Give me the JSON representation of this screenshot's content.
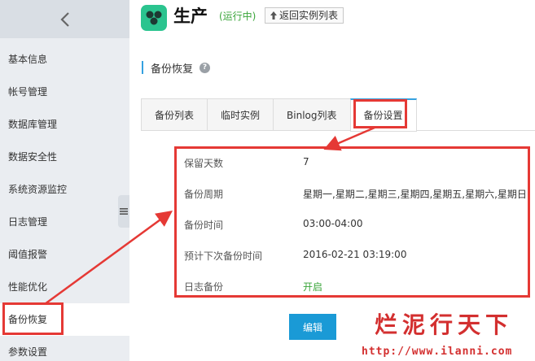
{
  "sidebar": {
    "items": [
      {
        "label": "基本信息"
      },
      {
        "label": "帐号管理"
      },
      {
        "label": "数据库管理"
      },
      {
        "label": "数据安全性"
      },
      {
        "label": "系统资源监控"
      },
      {
        "label": "日志管理"
      },
      {
        "label": "阈值报警"
      },
      {
        "label": "性能优化"
      },
      {
        "label": "备份恢复",
        "active": true
      },
      {
        "label": "参数设置"
      }
    ]
  },
  "header": {
    "title": "生产",
    "status": "(运行中)",
    "back_label": "返回实例列表"
  },
  "section": {
    "title": "备份恢复"
  },
  "tabs": [
    {
      "label": "备份列表"
    },
    {
      "label": "临时实例"
    },
    {
      "label": "Binlog列表"
    },
    {
      "label": "备份设置",
      "active": true
    }
  ],
  "settings": [
    {
      "label": "保留天数",
      "value": "7"
    },
    {
      "label": "备份周期",
      "value": "星期一,星期二,星期三,星期四,星期五,星期六,星期日"
    },
    {
      "label": "备份时间",
      "value": "03:00-04:00"
    },
    {
      "label": "预计下次备份时间",
      "value": "2016-02-21 03:19:00"
    },
    {
      "label": "日志备份",
      "value": "开启"
    }
  ],
  "edit_label": "编辑",
  "watermark": {
    "title": "烂泥行天下",
    "url": "http://www.ilanni.com"
  },
  "colors": {
    "accent": "#1a9ad6",
    "status_green": "#3aa53a",
    "highlight_red": "#e53935",
    "logo_green": "#2bc48f"
  }
}
